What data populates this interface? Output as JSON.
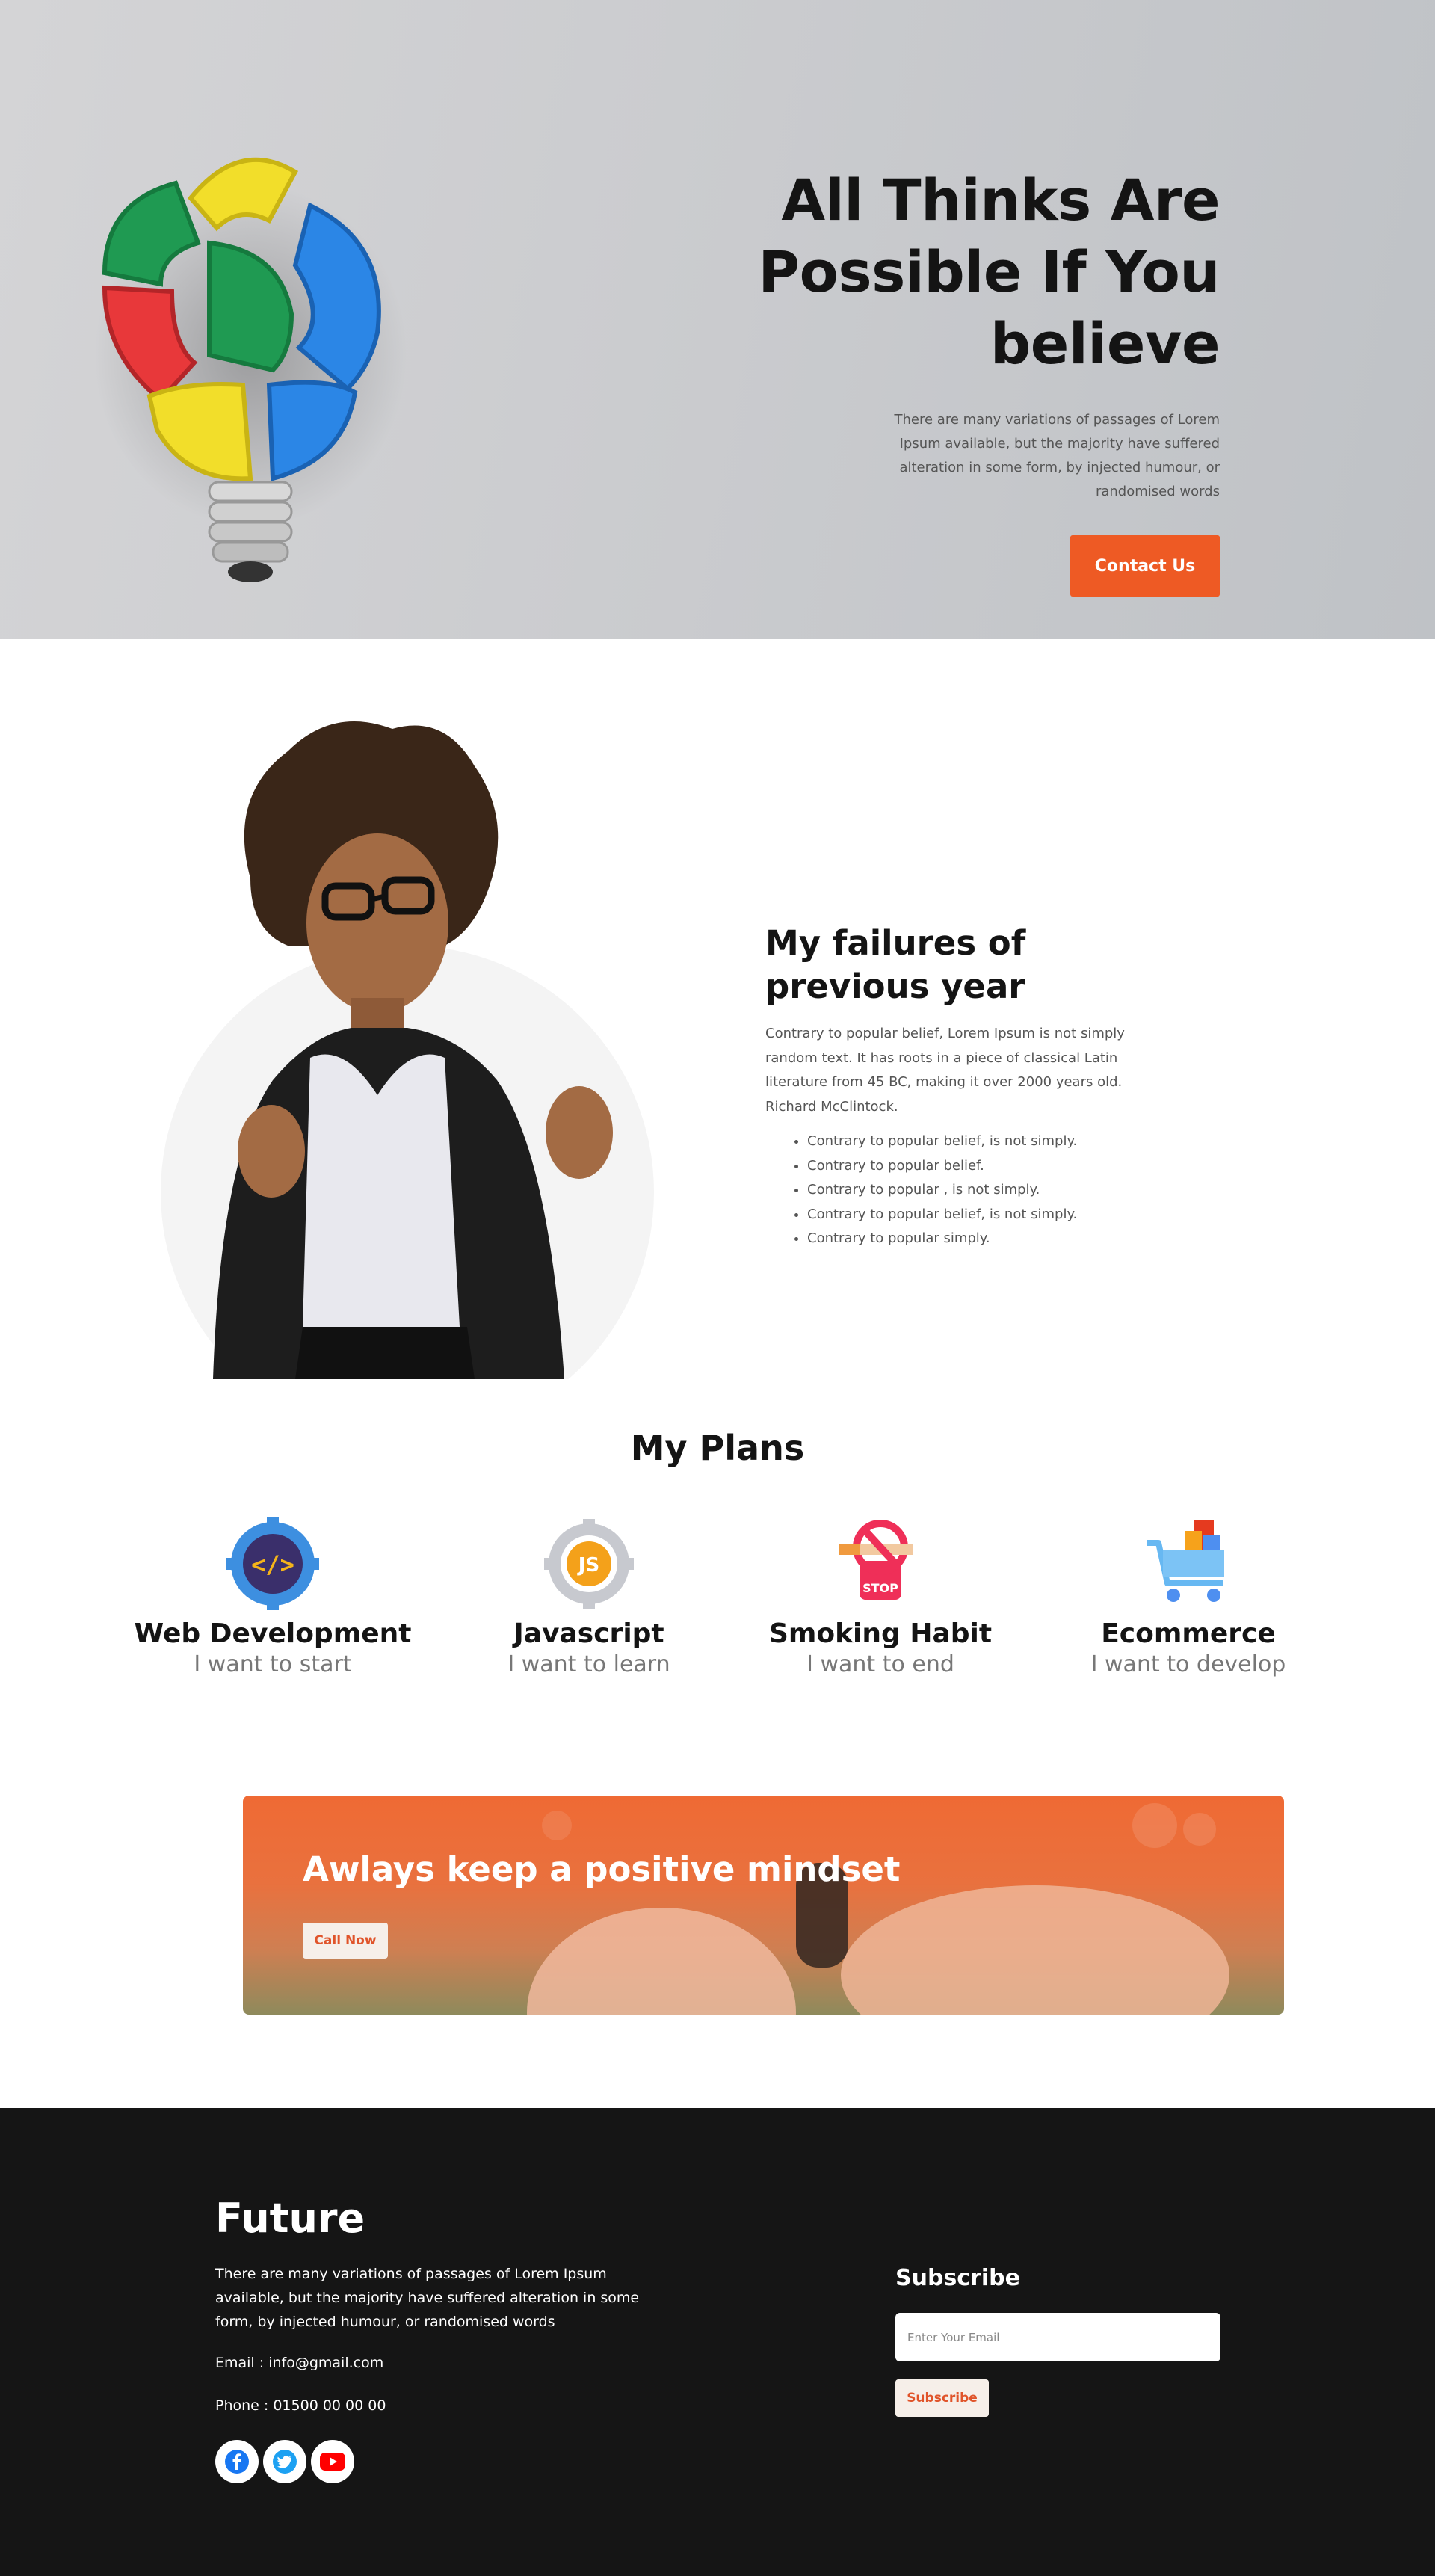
{
  "hero": {
    "title_line1": "All Thinks Are",
    "title_line2": "Possible If You",
    "title_line3": "believe",
    "description": "There are many variations of passages of Lorem Ipsum available, but the majority have suffered alteration in some form, by injected humour, or randomised words",
    "cta_label": "Contact Us"
  },
  "failures": {
    "title_line1": "My failures of",
    "title_line2": "previous year",
    "description": "Contrary to popular belief, Lorem Ipsum is not simply random text. It has roots in a piece of classical Latin literature from 45 BC, making it over 2000 years old. Richard McClintock.",
    "items": [
      "Contrary to popular belief, is not simply.",
      "Contrary to popular belief.",
      "Contrary to popular , is not simply.",
      "Contrary to popular belief, is not simply.",
      "Contrary to popular simply."
    ]
  },
  "plans": {
    "title": "My Plans",
    "items": [
      {
        "name": "Web Development",
        "sub": "I want to start",
        "icon": "code-gear-icon"
      },
      {
        "name": "Javascript",
        "sub": "I want to learn",
        "icon": "js-gear-icon"
      },
      {
        "name": "Smoking Habit",
        "sub": "I want to end",
        "icon": "no-smoking-icon"
      },
      {
        "name": "Ecommerce",
        "sub": "I want to develop",
        "icon": "shopping-cart-icon"
      }
    ]
  },
  "banner": {
    "title": "Awlays keep a positive mindset",
    "button_label": "Call Now"
  },
  "footer": {
    "brand": "Future",
    "description": "There are many variations of passages of Lorem Ipsum available, but the majority have suffered alteration in some form, by injected humour, or randomised words",
    "email": "Email : info@gmail.com",
    "phone": "Phone : 01500 00 00 00",
    "social": [
      "facebook-icon",
      "twitter-icon",
      "youtube-icon"
    ],
    "subscribe_title": "Subscribe",
    "email_placeholder": "Enter Your Email",
    "subscribe_button": "Subscribe"
  },
  "colors": {
    "accent": "#ee5a24",
    "footer_bg": "#151515",
    "heading": "#141414"
  }
}
